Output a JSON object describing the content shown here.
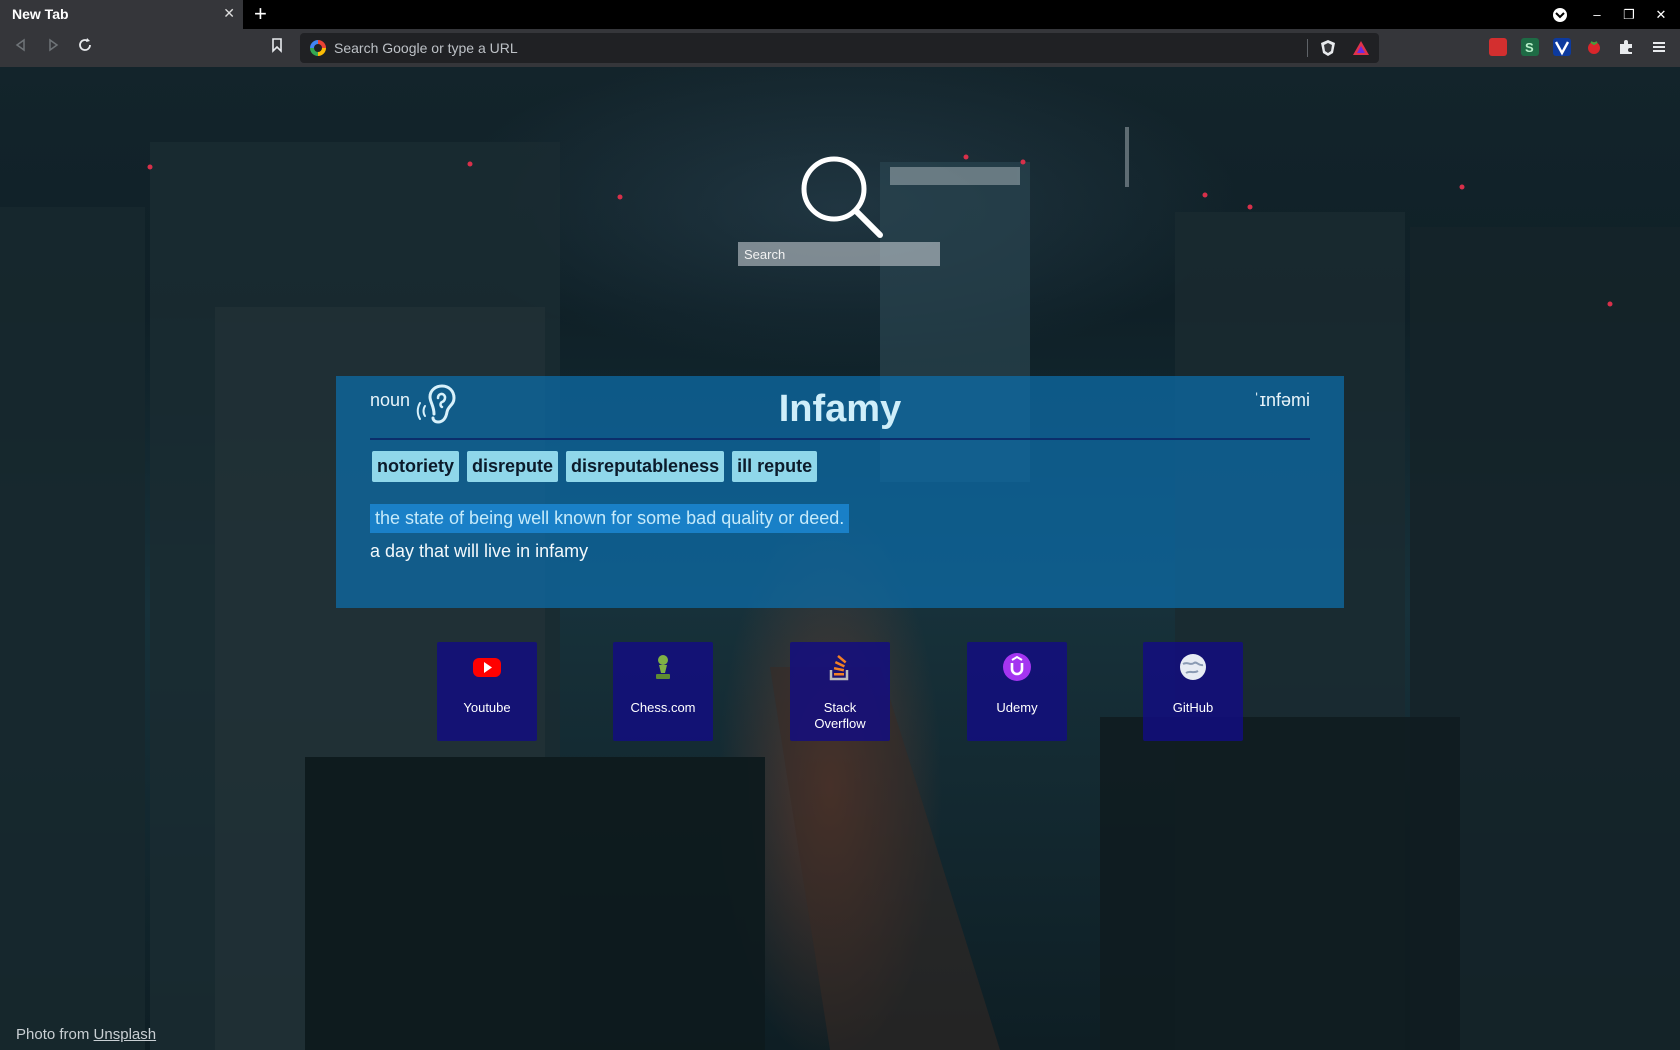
{
  "browser": {
    "tab_title": "New Tab",
    "tab_close": "✕",
    "new_tab": "+",
    "omnibox_placeholder": "Search Google or type a URL",
    "window_controls": [
      "–",
      "❐",
      "✕"
    ]
  },
  "search": {
    "placeholder": "Search",
    "icon": "magnifier-icon"
  },
  "dictionary": {
    "part_of_speech": "noun",
    "word": "Infamy",
    "phonetic": "ˈɪnfəmi",
    "synonyms": [
      "notoriety",
      "disrepute",
      "disreputableness",
      "ill repute"
    ],
    "definition": "the state of being well known for some bad quality or deed.",
    "example": "a day that will live in infamy",
    "audio_icon": "ear-icon"
  },
  "shortcuts": [
    {
      "label": "Youtube",
      "icon": "youtube-icon"
    },
    {
      "label": "Chess.com",
      "icon": "chess-pawn-icon"
    },
    {
      "label": "Stack Overflow",
      "icon": "stackoverflow-icon"
    },
    {
      "label": "Udemy",
      "icon": "udemy-icon"
    },
    {
      "label": "GitHub",
      "icon": "globe-icon"
    }
  ],
  "credit": {
    "prefix": "Photo from",
    "link": "Unsplash"
  },
  "colors": {
    "card": "#0c6eaa",
    "synonym_chip": "#8fd7ea",
    "shortcut_tile": "#120c82",
    "chrome_toolbar": "#35363a"
  }
}
